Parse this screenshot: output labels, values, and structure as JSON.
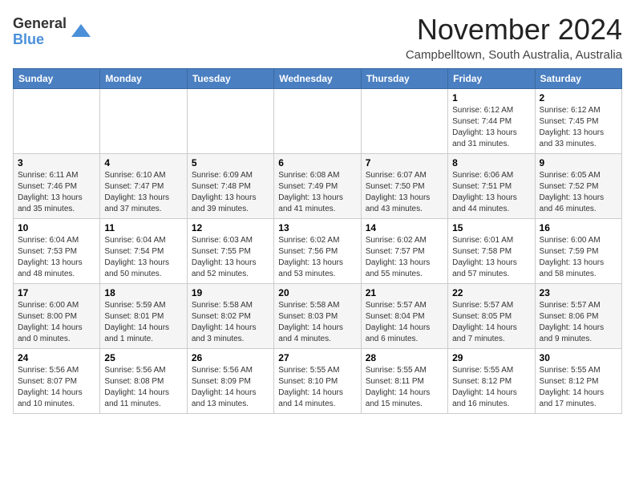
{
  "logo": {
    "general": "General",
    "blue": "Blue"
  },
  "title": "November 2024",
  "location": "Campbelltown, South Australia, Australia",
  "days_header": [
    "Sunday",
    "Monday",
    "Tuesday",
    "Wednesday",
    "Thursday",
    "Friday",
    "Saturday"
  ],
  "weeks": [
    [
      {
        "day": "",
        "info": ""
      },
      {
        "day": "",
        "info": ""
      },
      {
        "day": "",
        "info": ""
      },
      {
        "day": "",
        "info": ""
      },
      {
        "day": "",
        "info": ""
      },
      {
        "day": "1",
        "info": "Sunrise: 6:12 AM\nSunset: 7:44 PM\nDaylight: 13 hours\nand 31 minutes."
      },
      {
        "day": "2",
        "info": "Sunrise: 6:12 AM\nSunset: 7:45 PM\nDaylight: 13 hours\nand 33 minutes."
      }
    ],
    [
      {
        "day": "3",
        "info": "Sunrise: 6:11 AM\nSunset: 7:46 PM\nDaylight: 13 hours\nand 35 minutes."
      },
      {
        "day": "4",
        "info": "Sunrise: 6:10 AM\nSunset: 7:47 PM\nDaylight: 13 hours\nand 37 minutes."
      },
      {
        "day": "5",
        "info": "Sunrise: 6:09 AM\nSunset: 7:48 PM\nDaylight: 13 hours\nand 39 minutes."
      },
      {
        "day": "6",
        "info": "Sunrise: 6:08 AM\nSunset: 7:49 PM\nDaylight: 13 hours\nand 41 minutes."
      },
      {
        "day": "7",
        "info": "Sunrise: 6:07 AM\nSunset: 7:50 PM\nDaylight: 13 hours\nand 43 minutes."
      },
      {
        "day": "8",
        "info": "Sunrise: 6:06 AM\nSunset: 7:51 PM\nDaylight: 13 hours\nand 44 minutes."
      },
      {
        "day": "9",
        "info": "Sunrise: 6:05 AM\nSunset: 7:52 PM\nDaylight: 13 hours\nand 46 minutes."
      }
    ],
    [
      {
        "day": "10",
        "info": "Sunrise: 6:04 AM\nSunset: 7:53 PM\nDaylight: 13 hours\nand 48 minutes."
      },
      {
        "day": "11",
        "info": "Sunrise: 6:04 AM\nSunset: 7:54 PM\nDaylight: 13 hours\nand 50 minutes."
      },
      {
        "day": "12",
        "info": "Sunrise: 6:03 AM\nSunset: 7:55 PM\nDaylight: 13 hours\nand 52 minutes."
      },
      {
        "day": "13",
        "info": "Sunrise: 6:02 AM\nSunset: 7:56 PM\nDaylight: 13 hours\nand 53 minutes."
      },
      {
        "day": "14",
        "info": "Sunrise: 6:02 AM\nSunset: 7:57 PM\nDaylight: 13 hours\nand 55 minutes."
      },
      {
        "day": "15",
        "info": "Sunrise: 6:01 AM\nSunset: 7:58 PM\nDaylight: 13 hours\nand 57 minutes."
      },
      {
        "day": "16",
        "info": "Sunrise: 6:00 AM\nSunset: 7:59 PM\nDaylight: 13 hours\nand 58 minutes."
      }
    ],
    [
      {
        "day": "17",
        "info": "Sunrise: 6:00 AM\nSunset: 8:00 PM\nDaylight: 14 hours\nand 0 minutes."
      },
      {
        "day": "18",
        "info": "Sunrise: 5:59 AM\nSunset: 8:01 PM\nDaylight: 14 hours\nand 1 minute."
      },
      {
        "day": "19",
        "info": "Sunrise: 5:58 AM\nSunset: 8:02 PM\nDaylight: 14 hours\nand 3 minutes."
      },
      {
        "day": "20",
        "info": "Sunrise: 5:58 AM\nSunset: 8:03 PM\nDaylight: 14 hours\nand 4 minutes."
      },
      {
        "day": "21",
        "info": "Sunrise: 5:57 AM\nSunset: 8:04 PM\nDaylight: 14 hours\nand 6 minutes."
      },
      {
        "day": "22",
        "info": "Sunrise: 5:57 AM\nSunset: 8:05 PM\nDaylight: 14 hours\nand 7 minutes."
      },
      {
        "day": "23",
        "info": "Sunrise: 5:57 AM\nSunset: 8:06 PM\nDaylight: 14 hours\nand 9 minutes."
      }
    ],
    [
      {
        "day": "24",
        "info": "Sunrise: 5:56 AM\nSunset: 8:07 PM\nDaylight: 14 hours\nand 10 minutes."
      },
      {
        "day": "25",
        "info": "Sunrise: 5:56 AM\nSunset: 8:08 PM\nDaylight: 14 hours\nand 11 minutes."
      },
      {
        "day": "26",
        "info": "Sunrise: 5:56 AM\nSunset: 8:09 PM\nDaylight: 14 hours\nand 13 minutes."
      },
      {
        "day": "27",
        "info": "Sunrise: 5:55 AM\nSunset: 8:10 PM\nDaylight: 14 hours\nand 14 minutes."
      },
      {
        "day": "28",
        "info": "Sunrise: 5:55 AM\nSunset: 8:11 PM\nDaylight: 14 hours\nand 15 minutes."
      },
      {
        "day": "29",
        "info": "Sunrise: 5:55 AM\nSunset: 8:12 PM\nDaylight: 14 hours\nand 16 minutes."
      },
      {
        "day": "30",
        "info": "Sunrise: 5:55 AM\nSunset: 8:12 PM\nDaylight: 14 hours\nand 17 minutes."
      }
    ]
  ]
}
